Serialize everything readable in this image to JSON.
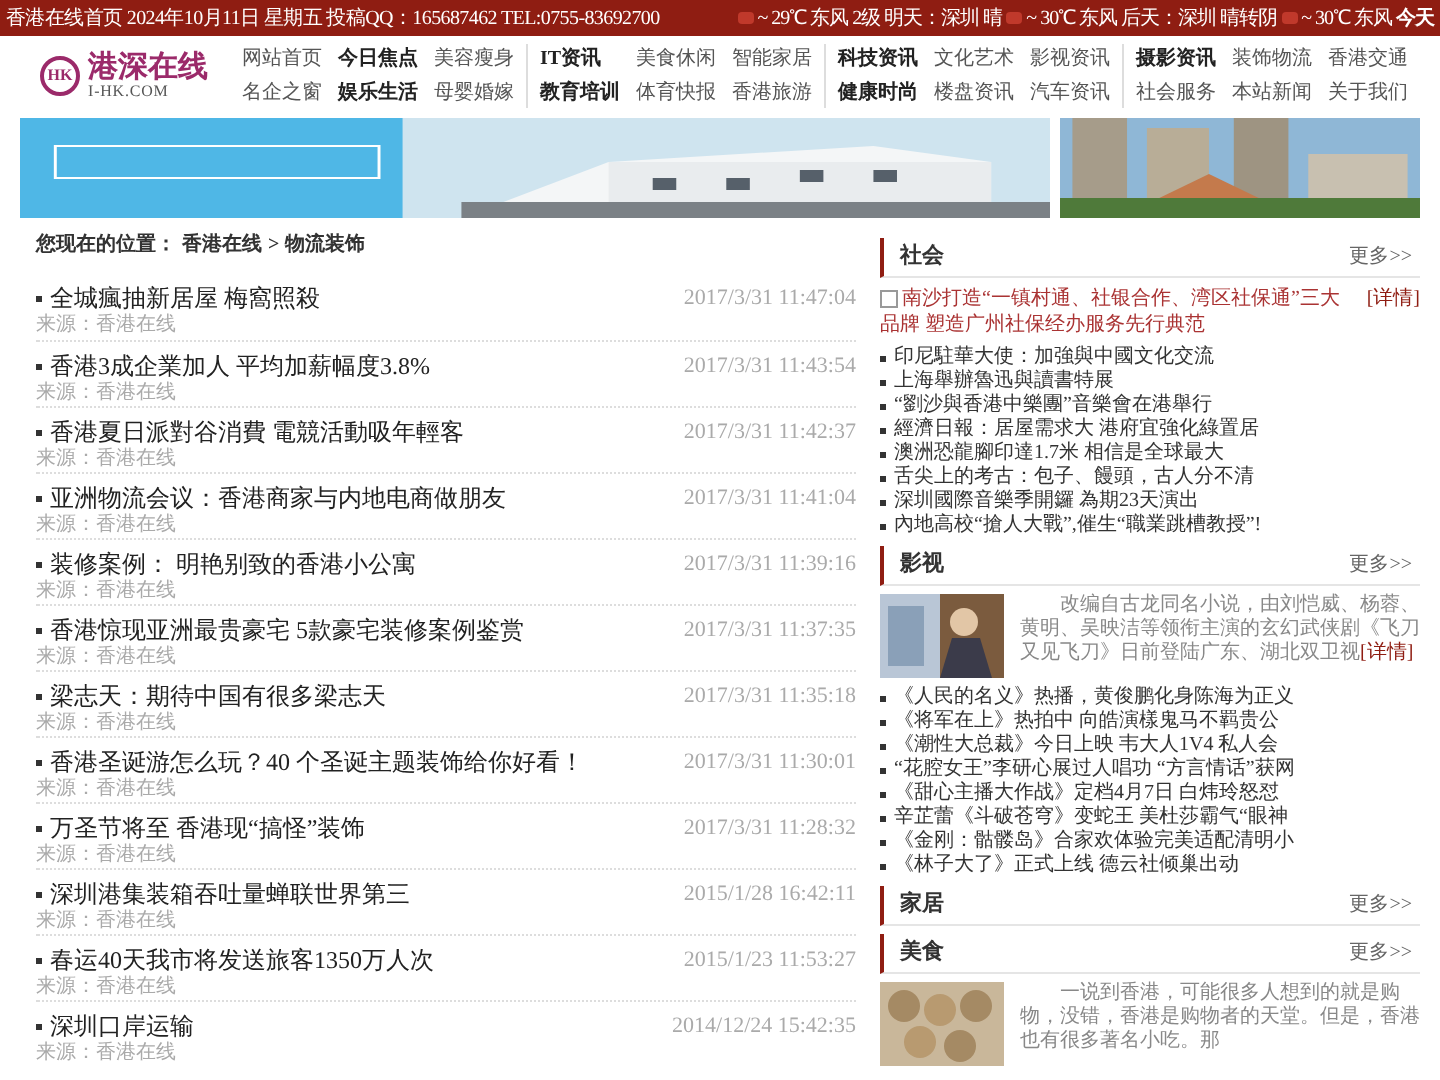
{
  "top_bar": {
    "info": "香港在线首页 2024年10月11日 星期五 投稿QQ：165687462 TEL:0755-83692700",
    "weather": [
      {
        "icon": true,
        "text": "~ 29℃ 东风 2级"
      },
      {
        "icon": false,
        "text": "明天：深圳 晴"
      },
      {
        "icon": true,
        "text": "~ 30℃ 东风"
      },
      {
        "icon": false,
        "text": "后天：深圳 晴转阴"
      },
      {
        "icon": true,
        "text": "~ 30℃ 东风"
      },
      {
        "icon": false,
        "text": "今天"
      }
    ]
  },
  "logo": {
    "mark": "HK",
    "name": "港深在线",
    "domain": "I-HK.COM"
  },
  "nav": [
    [
      {
        "label": "网站首页",
        "bold": false
      },
      {
        "label": "今日焦点",
        "bold": true
      },
      {
        "label": "美容瘦身",
        "bold": false
      },
      {
        "label": "名企之窗",
        "bold": false
      },
      {
        "label": "娱乐生活",
        "bold": true
      },
      {
        "label": "母婴婚嫁",
        "bold": false
      }
    ],
    [
      {
        "label": "IT资讯",
        "bold": true
      },
      {
        "label": "美食休闲",
        "bold": false
      },
      {
        "label": "智能家居",
        "bold": false
      },
      {
        "label": "教育培训",
        "bold": true
      },
      {
        "label": "体育快报",
        "bold": false
      },
      {
        "label": "香港旅游",
        "bold": false
      }
    ],
    [
      {
        "label": "科技资讯",
        "bold": true
      },
      {
        "label": "文化艺术",
        "bold": false
      },
      {
        "label": "影视资讯",
        "bold": false
      },
      {
        "label": "健康时尚",
        "bold": true
      },
      {
        "label": "楼盘资讯",
        "bold": false
      },
      {
        "label": "汽车资讯",
        "bold": false
      }
    ],
    [
      {
        "label": "摄影资讯",
        "bold": true
      },
      {
        "label": "装饰物流",
        "bold": false
      },
      {
        "label": "香港交通",
        "bold": false
      },
      {
        "label": "社会服务",
        "bold": false
      },
      {
        "label": "本站新闻",
        "bold": false
      },
      {
        "label": "关于我们",
        "bold": false
      }
    ]
  ],
  "breadcrumb": {
    "label": "您现在的位置：",
    "links": [
      "香港在线",
      "物流装饰"
    ],
    "separator": ">"
  },
  "articles": [
    {
      "title": "全城瘋抽新居屋 梅窩照殺",
      "source": "来源：香港在线",
      "date": "2017/3/31 11:47:04"
    },
    {
      "title": "香港3成企業加人 平均加薪幅度3.8%",
      "source": "来源：香港在线",
      "date": "2017/3/31 11:43:54"
    },
    {
      "title": "香港夏日派對谷消費 電競活動吸年輕客",
      "source": "来源：香港在线",
      "date": "2017/3/31 11:42:37"
    },
    {
      "title": "亚洲物流会议：香港商家与内地电商做朋友",
      "source": "来源：香港在线",
      "date": "2017/3/31 11:41:04"
    },
    {
      "title": "装修案例： 明艳别致的香港小公寓",
      "source": "来源：香港在线",
      "date": "2017/3/31 11:39:16"
    },
    {
      "title": "香港惊现亚洲最贵豪宅 5款豪宅装修案例鉴赏",
      "source": "来源：香港在线",
      "date": "2017/3/31 11:37:35"
    },
    {
      "title": "梁志天：期待中国有很多梁志天",
      "source": "来源：香港在线",
      "date": "2017/3/31 11:35:18"
    },
    {
      "title": "香港圣诞游怎么玩？40 个圣诞主题装饰给你好看！",
      "source": "来源：香港在线",
      "date": "2017/3/31 11:30:01"
    },
    {
      "title": "万圣节将至 香港现“搞怪”装饰",
      "source": "来源：香港在线",
      "date": "2017/3/31 11:28:32"
    },
    {
      "title": "深圳港集装箱吞吐量蝉联世界第三",
      "source": "来源：香港在线",
      "date": "2015/1/28 16:42:11"
    },
    {
      "title": "春运40天我市将发送旅客1350万人次",
      "source": "来源：香港在线",
      "date": "2015/1/23 11:53:27"
    },
    {
      "title": "深圳口岸运输",
      "source": "来源：香港在线",
      "date": "2014/12/24 15:42:35"
    }
  ],
  "sections": [
    {
      "title": "社会",
      "more": "更多>>",
      "feature": {
        "kind": "broken-image",
        "text": "南沙打造“一镇村通、社银合作、湾区社保通”三大品牌 塑造广州社保经办服务先行典范",
        "detail": "[详情]"
      },
      "items": [
        "印尼駐華大使：加強與中國文化交流",
        "上海舉辦魯迅與讀書特展",
        "“劉沙與香港中樂團”音樂會在港舉行",
        "經濟日報：居屋需求大 港府宜強化綠置居",
        "澳洲恐龍腳印達1.7米 相信是全球最大",
        "舌尖上的考古：包子、饅頭，古人分不清",
        "深圳國際音樂季開鑼 為期23天演出",
        "內地高校“搶人大戰”,催生“職業跳槽教授”!"
      ]
    },
    {
      "title": "影视",
      "more": "更多>>",
      "feature": {
        "kind": "picture",
        "text": "改编自古龙同名小说，由刘恺威、杨蓉、黄明、吴映洁等领衔主演的玄幻武侠剧《飞刀又见飞刀》日前登陆广东、湖北双卫视",
        "detail": "[详情]"
      },
      "items": [
        "《人民的名义》热播，黄俊鹏化身陈海为正义",
        "《将军在上》热拍中 向皓演樣鬼马不羁贵公",
        "《潮性大总裁》今日上映 韦大人1V4 私人会",
        "“花腔女王”李研心展过人唱功 “方言情话”获网",
        "《甜心主播大作战》定档4月7日 白炜玲怒怼",
        "辛芷蕾《斗破苍穹》变蛇王 美杜莎霸气“眼神",
        "《金刚：骷髅岛》合家欢体验完美适配清明小",
        "《林子大了》正式上线 德云社倾巢出动"
      ]
    },
    {
      "title": "家居",
      "more": "更多>>"
    },
    {
      "title": "美食",
      "more": "更多>>",
      "feature": {
        "kind": "picture",
        "text": "一说到香港，可能很多人想到的就是购物，没错，香港是购物者的天堂。但是，香港也有很多著名小吃。那"
      }
    }
  ]
}
